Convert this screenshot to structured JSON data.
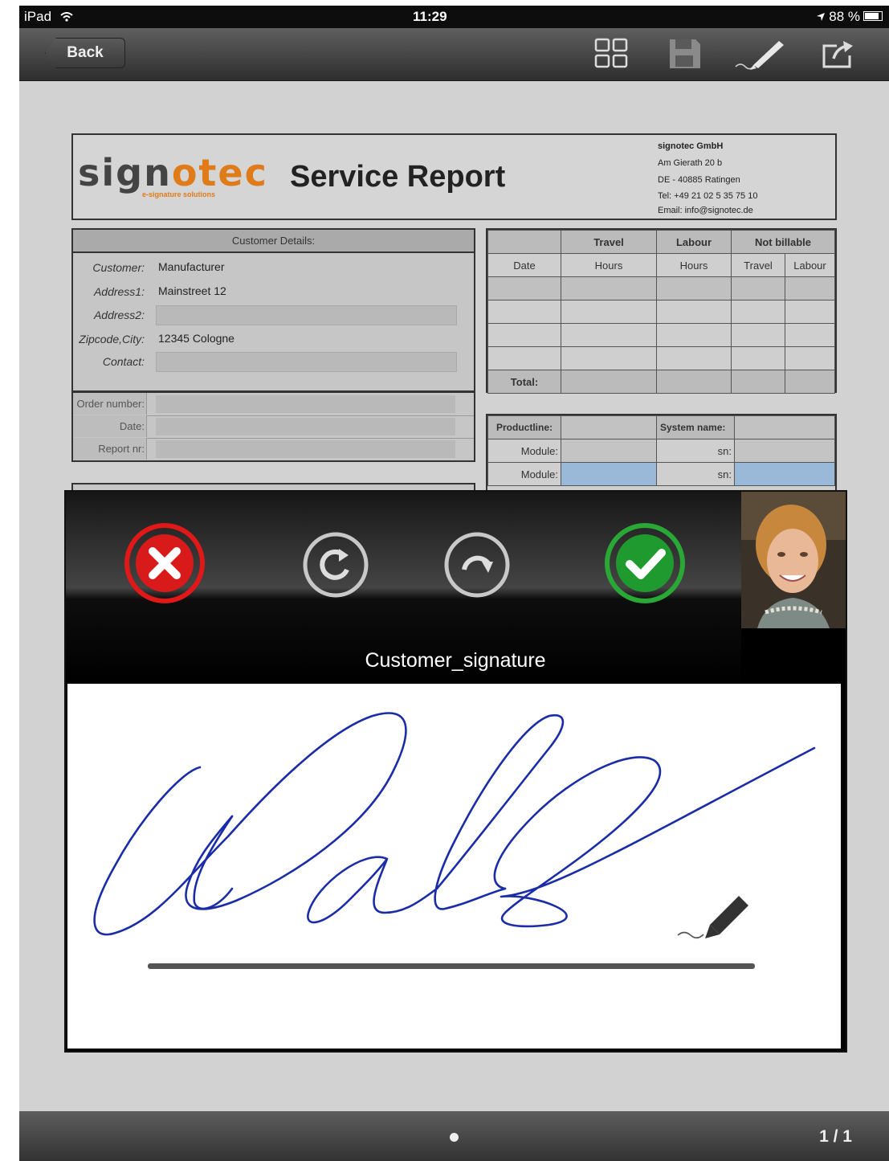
{
  "status_bar": {
    "carrier": "iPad",
    "time": "11:29",
    "battery": "88 %"
  },
  "nav": {
    "back_label": "Back"
  },
  "document": {
    "logo_prefix": "sign",
    "logo_suffix": "otec",
    "logo_tagline": "e-signature solutions",
    "title": "Service Report",
    "company": [
      "signotec GmbH",
      "Am Gierath 20 b",
      "DE - 40885 Ratingen",
      "Tel: +49 21 02 5 35 75 10",
      "Email: info@signotec.de"
    ],
    "customer_header": "Customer Details:",
    "customer_fields": [
      {
        "label": "Customer:",
        "value": "Manufacturer"
      },
      {
        "label": "Address1:",
        "value": "Mainstreet 12"
      },
      {
        "label": "Address2:",
        "value": ""
      },
      {
        "label": "Zipcode,City:",
        "value": "12345 Cologne"
      },
      {
        "label": "Contact:",
        "value": ""
      }
    ],
    "order_fields": [
      "Order number:",
      "Date:",
      "Report nr:"
    ],
    "hours_table": {
      "group_headers": [
        "Travel",
        "Labour",
        "Not billable"
      ],
      "col_headers": [
        "Date",
        "Hours",
        "Hours",
        "Travel",
        "Labour"
      ],
      "total_label": "Total:"
    },
    "product_table": {
      "productline_label": "Productline:",
      "system_label": "System name:",
      "module_label": "Module:",
      "sn_label": "sn:"
    }
  },
  "signature": {
    "field_name": "Customer_signature",
    "cancel_label": "cancel-icon",
    "undo_label": "undo-icon",
    "redo_label": "redo-icon",
    "confirm_label": "confirm-icon",
    "ink_color": "#1a2ca8"
  },
  "footer": {
    "page_indicator": "1 / 1"
  }
}
